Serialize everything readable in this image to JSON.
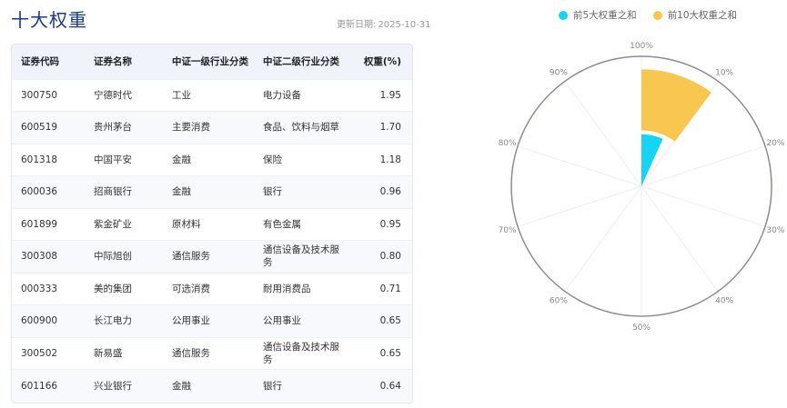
{
  "header": {
    "title": "十大权重",
    "update_label": "更新日期:",
    "update_date": "2025-10-31"
  },
  "table": {
    "columns": [
      "证券代码",
      "证券名称",
      "中证一级行业分类",
      "中证二级行业分类",
      "权重(%)"
    ],
    "rows": [
      [
        "300750",
        "宁德时代",
        "工业",
        "电力设备",
        "1.95"
      ],
      [
        "600519",
        "贵州茅台",
        "主要消费",
        "食品、饮料与烟草",
        "1.70"
      ],
      [
        "601318",
        "中国平安",
        "金融",
        "保险",
        "1.18"
      ],
      [
        "600036",
        "招商银行",
        "金融",
        "银行",
        "0.96"
      ],
      [
        "601899",
        "紫金矿业",
        "原材料",
        "有色金属",
        "0.95"
      ],
      [
        "300308",
        "中际旭创",
        "通信服务",
        "通信设备及技术服务",
        "0.80"
      ],
      [
        "000333",
        "美的集团",
        "可选消费",
        "耐用消费品",
        "0.71"
      ],
      [
        "600900",
        "长江电力",
        "公用事业",
        "公用事业",
        "0.65"
      ],
      [
        "300502",
        "新易盛",
        "通信服务",
        "通信设备及技术服务",
        "0.65"
      ],
      [
        "601166",
        "兴业银行",
        "金融",
        "银行",
        "0.64"
      ]
    ]
  },
  "chart_data": {
    "type": "polar-bar",
    "series": [
      {
        "name": "前5大权重之和",
        "value": 6.74,
        "color": "#17d4f5"
      },
      {
        "name": "前10大权重之和",
        "value": 10.19,
        "color": "#f9c74f"
      }
    ],
    "angle_axis": {
      "min": 0,
      "max": 100,
      "ticks": [
        "100%",
        "10%",
        "20%",
        "30%",
        "40%",
        "50%",
        "60%",
        "70%",
        "80%",
        "90%"
      ]
    },
    "legend_position": "top-right"
  }
}
